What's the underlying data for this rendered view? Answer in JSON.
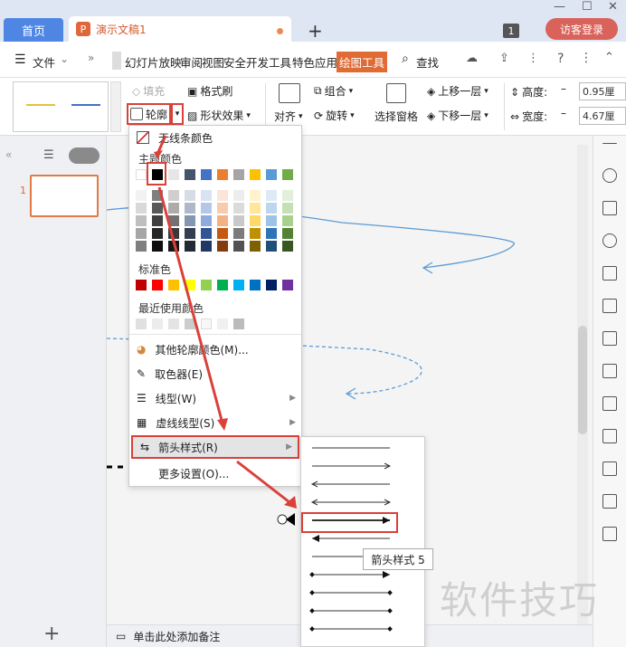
{
  "tabs": {
    "home": "首页",
    "doc": "演示文稿1",
    "doc_icon": "P",
    "new_tab": "+"
  },
  "titlebar": {
    "badge": "1",
    "login": "访客登录",
    "minimize": "—",
    "maximize": "☐",
    "close": "✕"
  },
  "menu": {
    "file": "文件",
    "items": [
      "幻灯片放映",
      "审阅",
      "视图",
      "安全",
      "开发工具",
      "特色应用"
    ],
    "active": "绘图工具",
    "search": "查找"
  },
  "ribbon": {
    "fill": "填充",
    "format_brush": "格式刷",
    "outline": "轮廓",
    "shape_effects": "形状效果",
    "align": "对齐",
    "group": "组合",
    "rotate": "旋转",
    "selection_pane": "选择窗格",
    "bring_forward": "上移一层",
    "send_backward": "下移一层",
    "height_label": "高度:",
    "height_value": "0.95厘",
    "width_label": "宽度:",
    "width_value": "4.67厘"
  },
  "popup": {
    "no_outline": "无线条颜色",
    "theme_colors": "主题颜色",
    "standard_colors": "标准色",
    "recent_colors": "最近使用颜色",
    "more_colors": "其他轮廓颜色(M)...",
    "eyedropper": "取色器(E)",
    "line_type": "线型(W)",
    "dash_type": "虚线线型(S)",
    "arrow_style": "箭头样式(R)",
    "more_settings": "更多设置(O)..."
  },
  "theme_top": [
    "#ffffff",
    "#000000",
    "#e7e6e6",
    "#44546a",
    "#4472c4",
    "#ed7d31",
    "#a5a5a5",
    "#ffc000",
    "#5b9bd5",
    "#70ad47"
  ],
  "theme_shades": [
    [
      "#f2f2f2",
      "#7f7f7f",
      "#d0cece",
      "#d6dce5",
      "#dae3f3",
      "#fbe5d6",
      "#ededed",
      "#fff2cc",
      "#deebf7",
      "#e2f0d9"
    ],
    [
      "#d9d9d9",
      "#595959",
      "#aeabab",
      "#adb9ca",
      "#b4c7e7",
      "#f8cbad",
      "#dbdbdb",
      "#ffe699",
      "#bdd7ee",
      "#c5e0b4"
    ],
    [
      "#bfbfbf",
      "#404040",
      "#757171",
      "#8497b0",
      "#8faadc",
      "#f4b183",
      "#c9c9c9",
      "#ffd966",
      "#9dc3e6",
      "#a9d18e"
    ],
    [
      "#a6a6a6",
      "#262626",
      "#3a3838",
      "#333f50",
      "#2f5597",
      "#c55a11",
      "#7b7b7b",
      "#bf9000",
      "#2e75b6",
      "#548235"
    ],
    [
      "#7f7f7f",
      "#0d0d0d",
      "#171616",
      "#222a35",
      "#203864",
      "#843c0c",
      "#525252",
      "#7f6000",
      "#1f4e79",
      "#385723"
    ]
  ],
  "standard": [
    "#c00000",
    "#ff0000",
    "#ffc000",
    "#ffff00",
    "#92d050",
    "#00b050",
    "#00b0f0",
    "#0070c0",
    "#002060",
    "#7030a0"
  ],
  "recent": [
    "#e0e0e0",
    "#ececec",
    "#e4e4e4",
    "#cccccc",
    "#f7f7f7",
    "#f0f0f0",
    "#bbbbbb"
  ],
  "slides": {
    "number": "1"
  },
  "tooltip": "箭头样式 5",
  "watermark": "软件技巧",
  "notes": "单击此处添加备注",
  "accent": "#e06b35",
  "highlight": "#d9413a"
}
